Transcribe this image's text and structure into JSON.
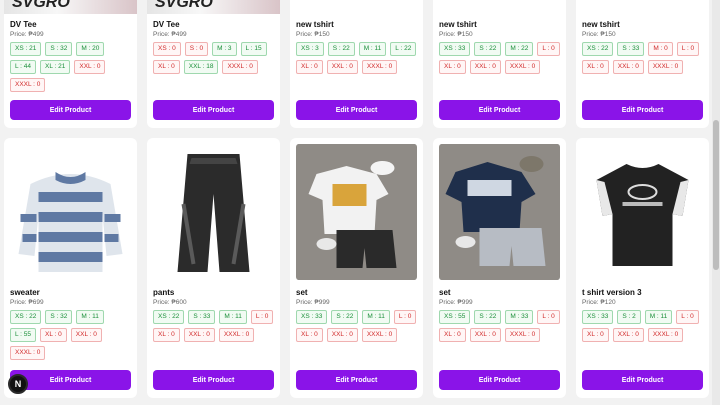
{
  "row1": [
    {
      "brand": "SVGRO",
      "name": "DV Tee",
      "price": "Price: ₱499",
      "stock": [
        {
          "label": "XS : 21",
          "ok": true
        },
        {
          "label": "S : 32",
          "ok": true
        },
        {
          "label": "M : 20",
          "ok": true
        },
        {
          "label": "L : 44",
          "ok": true
        },
        {
          "label": "XL : 21",
          "ok": true
        },
        {
          "label": "XXL : 0",
          "ok": false
        },
        {
          "label": "XXXL : 0",
          "ok": false
        }
      ],
      "button": "Edit Product"
    },
    {
      "brand": "SVGRO",
      "name": "DV Tee",
      "price": "Price: ₱499",
      "stock": [
        {
          "label": "XS : 0",
          "ok": false
        },
        {
          "label": "S : 0",
          "ok": false
        },
        {
          "label": "M : 3",
          "ok": true
        },
        {
          "label": "L : 15",
          "ok": true
        },
        {
          "label": "XL : 0",
          "ok": false
        },
        {
          "label": "XXL : 18",
          "ok": true
        },
        {
          "label": "XXXL : 0",
          "ok": false
        }
      ],
      "button": "Edit Product"
    },
    {
      "brand": "",
      "name": "new tshirt",
      "price": "Price: ₱150",
      "stock": [
        {
          "label": "XS : 3",
          "ok": true
        },
        {
          "label": "S : 22",
          "ok": true
        },
        {
          "label": "M : 11",
          "ok": true
        },
        {
          "label": "L : 22",
          "ok": true
        },
        {
          "label": "XL : 0",
          "ok": false
        },
        {
          "label": "XXL : 0",
          "ok": false
        },
        {
          "label": "XXXL : 0",
          "ok": false
        }
      ],
      "button": "Edit Product"
    },
    {
      "brand": "",
      "name": "new tshirt",
      "price": "Price: ₱150",
      "stock": [
        {
          "label": "XS : 33",
          "ok": true
        },
        {
          "label": "S : 22",
          "ok": true
        },
        {
          "label": "M : 22",
          "ok": true
        },
        {
          "label": "L : 0",
          "ok": false
        },
        {
          "label": "XL : 0",
          "ok": false
        },
        {
          "label": "XXL : 0",
          "ok": false
        },
        {
          "label": "XXXL : 0",
          "ok": false
        }
      ],
      "button": "Edit Product"
    },
    {
      "brand": "",
      "name": "new tshirt",
      "price": "Price: ₱150",
      "stock": [
        {
          "label": "XS : 22",
          "ok": true
        },
        {
          "label": "S : 33",
          "ok": true
        },
        {
          "label": "M : 0",
          "ok": false
        },
        {
          "label": "L : 0",
          "ok": false
        },
        {
          "label": "XL : 0",
          "ok": false
        },
        {
          "label": "XXL : 0",
          "ok": false
        },
        {
          "label": "XXXL : 0",
          "ok": false
        }
      ],
      "button": "Edit Product"
    }
  ],
  "row2": [
    {
      "name": "sweater",
      "price": "Price: ₱699",
      "image": "striped-sweater",
      "stock": [
        {
          "label": "XS : 22",
          "ok": true
        },
        {
          "label": "S : 32",
          "ok": true
        },
        {
          "label": "M : 11",
          "ok": true
        },
        {
          "label": "L : 55",
          "ok": true
        },
        {
          "label": "XL : 0",
          "ok": false
        },
        {
          "label": "XXL : 0",
          "ok": false
        },
        {
          "label": "XXXL : 0",
          "ok": false
        }
      ],
      "button": "Edit Product"
    },
    {
      "name": "pants",
      "price": "Price: ₱600",
      "image": "black-pants",
      "stock": [
        {
          "label": "XS : 22",
          "ok": true
        },
        {
          "label": "S : 33",
          "ok": true
        },
        {
          "label": "M : 11",
          "ok": true
        },
        {
          "label": "L : 0",
          "ok": false
        },
        {
          "label": "XL : 0",
          "ok": false
        },
        {
          "label": "XXL : 0",
          "ok": false
        },
        {
          "label": "XXXL : 0",
          "ok": false
        }
      ],
      "button": "Edit Product"
    },
    {
      "name": "set",
      "price": "Price: ₱999",
      "image": "outfit-set-white",
      "stock": [
        {
          "label": "XS : 33",
          "ok": true
        },
        {
          "label": "S : 22",
          "ok": true
        },
        {
          "label": "M : 11",
          "ok": true
        },
        {
          "label": "L : 0",
          "ok": false
        },
        {
          "label": "XL : 0",
          "ok": false
        },
        {
          "label": "XXL : 0",
          "ok": false
        },
        {
          "label": "XXXL : 0",
          "ok": false
        }
      ],
      "button": "Edit Product"
    },
    {
      "name": "set",
      "price": "Price: ₱999",
      "image": "outfit-set-navy",
      "stock": [
        {
          "label": "XS : 55",
          "ok": true
        },
        {
          "label": "S : 22",
          "ok": true
        },
        {
          "label": "M : 33",
          "ok": true
        },
        {
          "label": "L : 0",
          "ok": false
        },
        {
          "label": "XL : 0",
          "ok": false
        },
        {
          "label": "XXL : 0",
          "ok": false
        },
        {
          "label": "XXXL : 0",
          "ok": false
        }
      ],
      "button": "Edit Product"
    },
    {
      "name": "t shirt version 3",
      "price": "Price: ₱120",
      "image": "black-tshirt",
      "stock": [
        {
          "label": "XS : 33",
          "ok": true
        },
        {
          "label": "S : 2",
          "ok": true
        },
        {
          "label": "M : 11",
          "ok": true
        },
        {
          "label": "L : 0",
          "ok": false
        },
        {
          "label": "XL : 0",
          "ok": false
        },
        {
          "label": "XXL : 0",
          "ok": false
        },
        {
          "label": "XXXL : 0",
          "ok": false
        }
      ],
      "button": "Edit Product"
    }
  ],
  "floating_badge": "N",
  "colors": {
    "button": "#8a14e8",
    "in_stock": "#1b8f3a",
    "out_of_stock": "#d12a2a"
  }
}
